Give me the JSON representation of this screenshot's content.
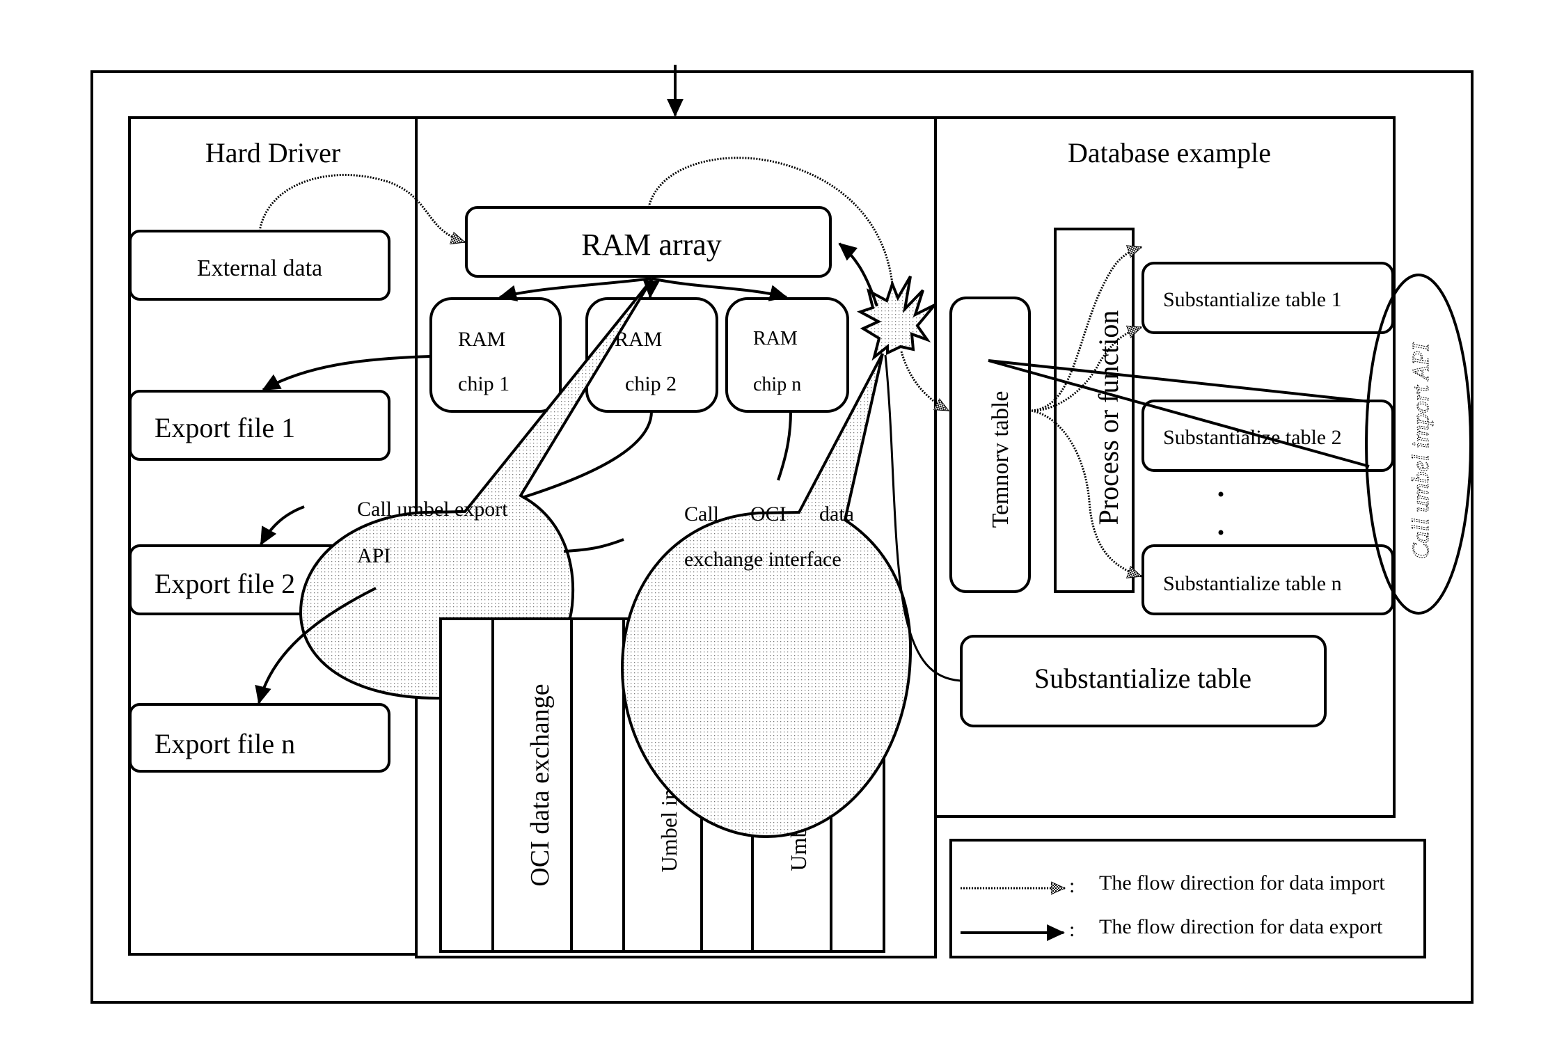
{
  "panels": {
    "hard_driver": {
      "title": "Hard Driver",
      "external_data": "External data",
      "export_files": [
        "Export file 1",
        "Export file 2",
        "Export file n"
      ]
    },
    "memory": {
      "ram_array": "RAM array",
      "chips": [
        {
          "line1": "RAM",
          "line2": "chip 1"
        },
        {
          "line1": "RAM",
          "line2": "chip 2"
        },
        {
          "line1": "RAM",
          "line2": "chip n"
        }
      ],
      "callout_export": {
        "line1": "Call umbel export",
        "line2": "API"
      },
      "callout_oci": {
        "line1a": "Call",
        "line1b": "OCI",
        "line1c": "data",
        "line2": "exchange interface"
      },
      "api_columns": [
        "OCI data exchange",
        "Umbel import API",
        "Umbel export API"
      ]
    },
    "database": {
      "title": "Database example",
      "temporary_table": "Temnorv table",
      "process": "Process or function",
      "tables": [
        "Substantialize table 1",
        "Substantialize table 2",
        "Substantialize table n"
      ],
      "ellipsis": "· · ·",
      "substantialize_table": "Substantialize table",
      "import_api_callout": "Call umbel import API"
    }
  },
  "legend": {
    "import_label": "The flow direction for data import",
    "export_label": "The flow direction for data export",
    "separator": ":"
  }
}
